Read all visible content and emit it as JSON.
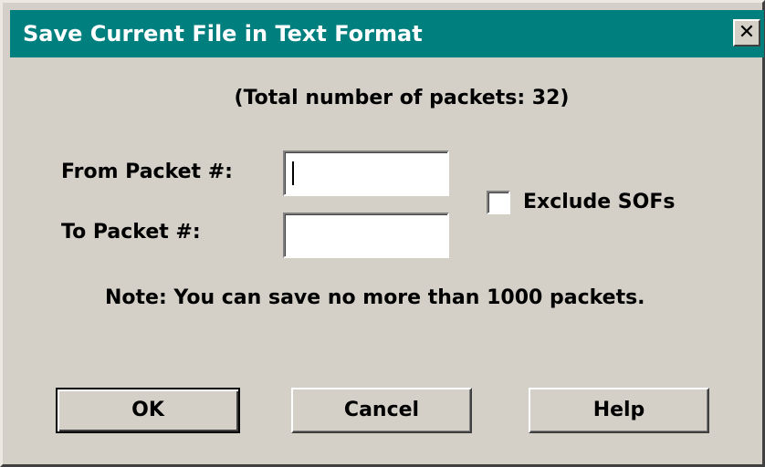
{
  "window": {
    "title": "Save Current File in Text Format",
    "close_glyph": "✕"
  },
  "info": {
    "total_text": "(Total number of packets: 32)"
  },
  "form": {
    "from_label": "From Packet #:",
    "from_value": "",
    "to_label": "To Packet #:",
    "to_value": "",
    "exclude_sofs_label": "Exclude SOFs",
    "exclude_sofs_checked": false
  },
  "note": "Note: You can save no more than 1000 packets.",
  "buttons": {
    "ok": "OK",
    "cancel": "Cancel",
    "help": "Help"
  },
  "colors": {
    "titlebar": "#007f7f",
    "dialog_bg": "#d4d0c8"
  }
}
